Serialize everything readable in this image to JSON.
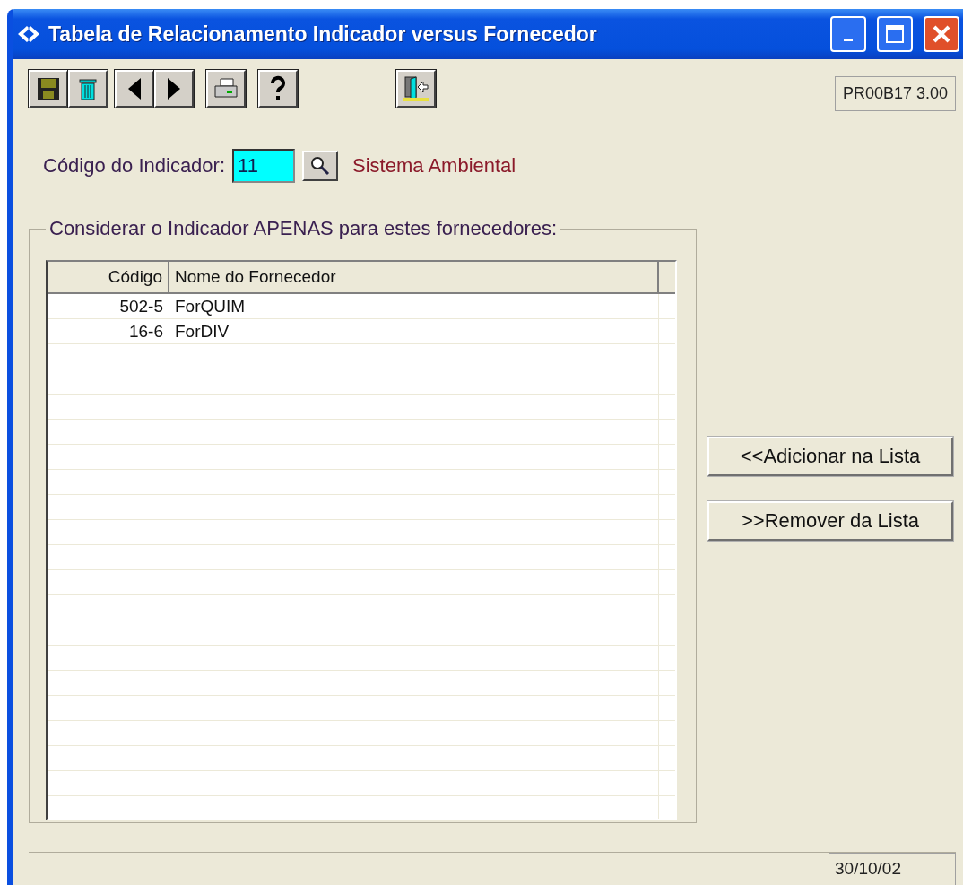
{
  "window": {
    "title": "Tabela de Relacionamento Indicador versus Fornecedor"
  },
  "toolbar": {
    "buttons": [
      {
        "kind": "save"
      },
      {
        "kind": "delete"
      },
      {
        "kind": "prev"
      },
      {
        "kind": "next"
      },
      {
        "kind": "print"
      },
      {
        "kind": "help"
      },
      {
        "kind": "exit"
      }
    ]
  },
  "version": "PR00B17 3.00",
  "indicator": {
    "label": "Código do Indicador:",
    "value": "11",
    "description": "Sistema Ambiental"
  },
  "group": {
    "title": "Considerar o Indicador APENAS para estes fornecedores:"
  },
  "table": {
    "columns": [
      "Código",
      "Nome do Fornecedor"
    ],
    "rows": [
      {
        "code": "502-5",
        "name": "ForQUIM"
      },
      {
        "code": "16-6",
        "name": "ForDIV"
      }
    ]
  },
  "actions": [
    "<<Adicionar na Lista",
    ">>Remover da Lista"
  ],
  "status_bar": {
    "date": "30/10/02"
  }
}
